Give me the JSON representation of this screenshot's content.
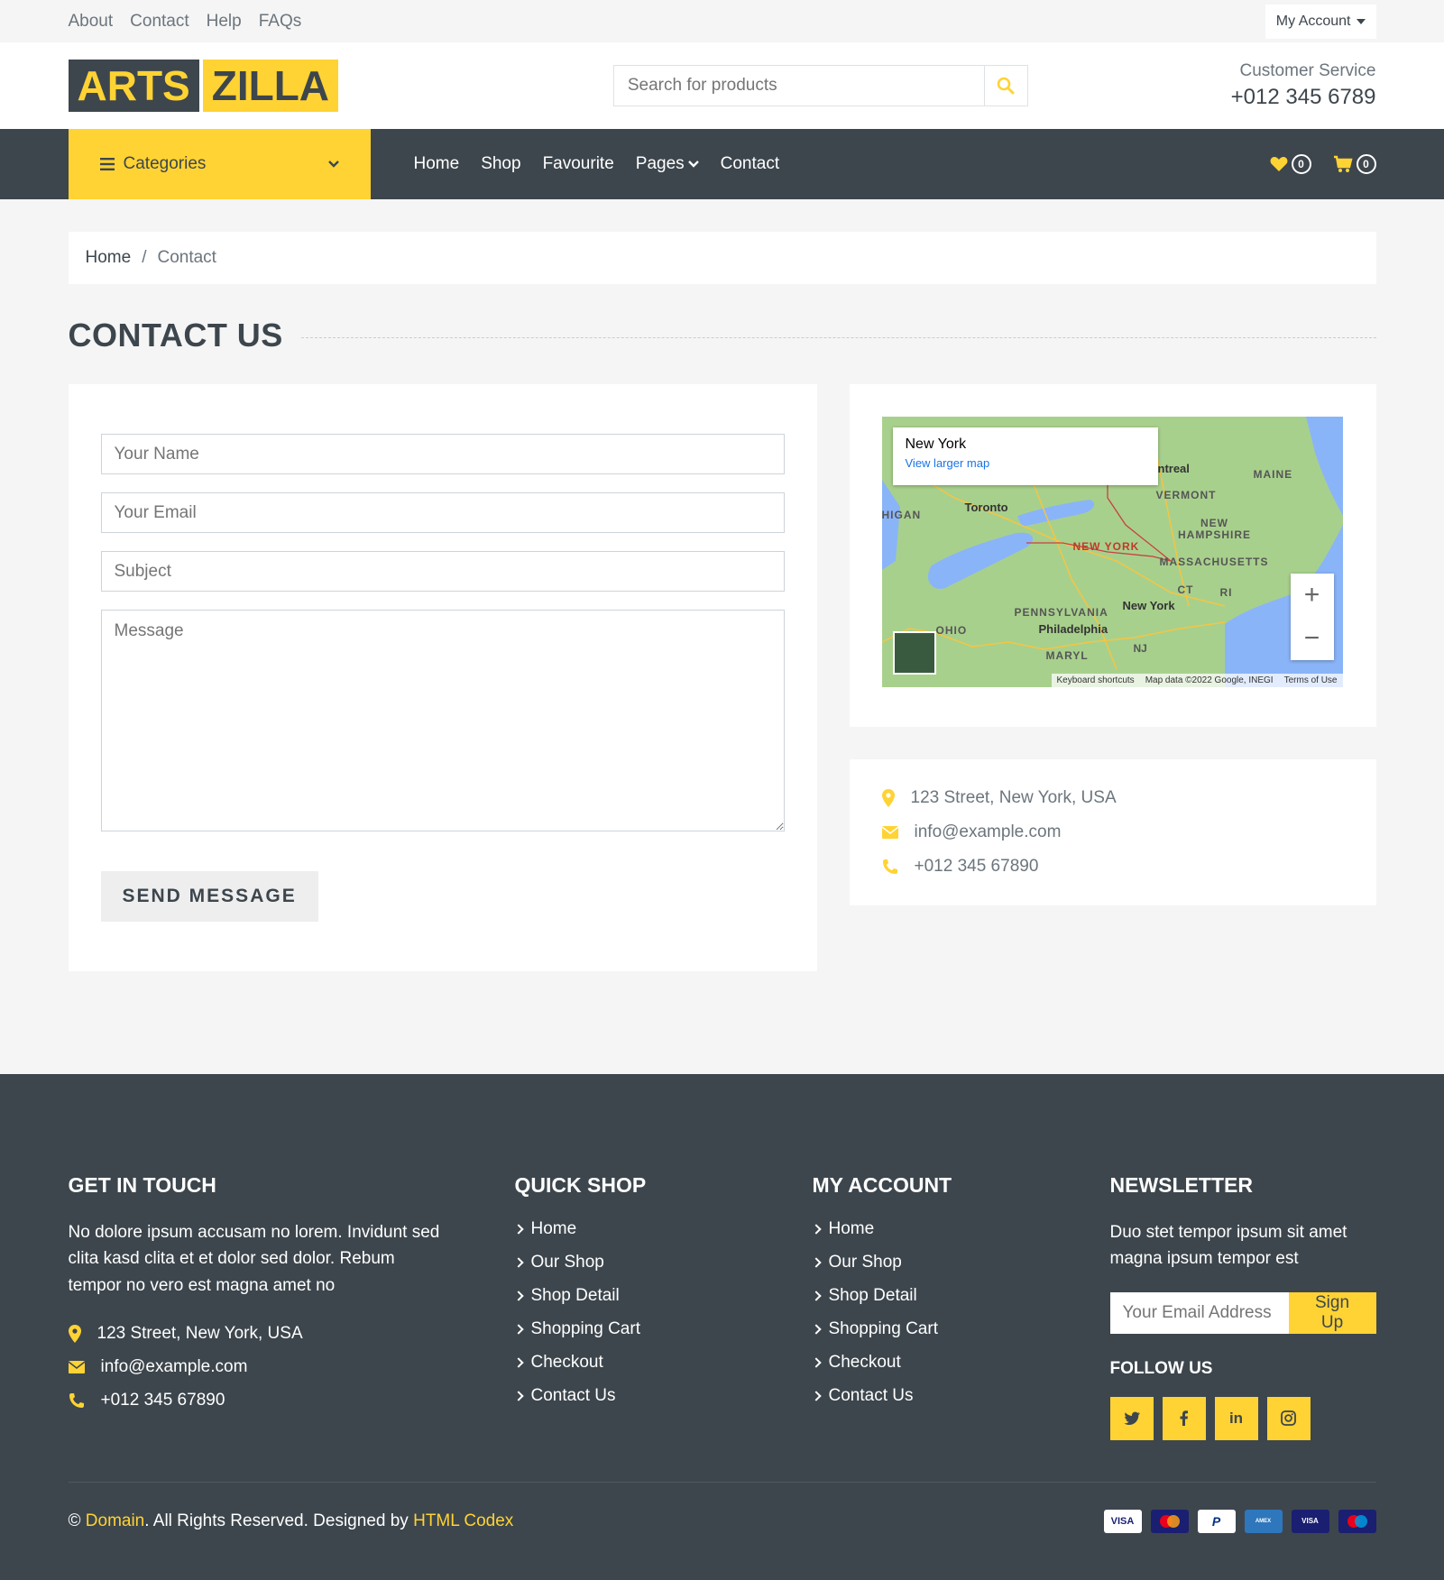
{
  "topbar": {
    "links": [
      "About",
      "Contact",
      "Help",
      "FAQs"
    ],
    "account_label": "My Account"
  },
  "header": {
    "logo_part1": "ARTS",
    "logo_part2": "ZILLA",
    "search_placeholder": "Search for products",
    "cs_title": "Customer Service",
    "cs_phone": "+012 345 6789"
  },
  "nav": {
    "categories_label": "Categories",
    "menu": [
      "Home",
      "Shop",
      "Favourite",
      "Pages",
      "Contact"
    ],
    "wishlist_count": "0",
    "cart_count": "0"
  },
  "breadcrumb": {
    "home": "Home",
    "separator": "/",
    "current": "Contact"
  },
  "page_title": "CONTACT US",
  "form": {
    "name_placeholder": "Your Name",
    "email_placeholder": "Your Email",
    "subject_placeholder": "Subject",
    "message_placeholder": "Message",
    "send_label": "SEND MESSAGE"
  },
  "map": {
    "place": "New York",
    "view_larger": "View larger map",
    "labels": {
      "toronto": "Toronto",
      "new_york_state": "NEW YORK",
      "vermont": "VERMONT",
      "maine": "MAINE",
      "new_hampshire": "NEW HAMPSHIRE",
      "massachusetts": "MASSACHUSETTS",
      "ct": "CT",
      "ri": "RI",
      "pennsylvania": "PENNSYLVANIA",
      "new_york_city": "New York",
      "philadelphia": "Philadelphia",
      "nj": "NJ",
      "montreal": "ntreal",
      "michigan": "HIGAN",
      "ohio": "OHIO",
      "maryland": "MARYL"
    },
    "footer": [
      "Keyboard shortcuts",
      "Map data ©2022 Google, INEGI",
      "Terms of Use"
    ],
    "zoom_in": "+",
    "zoom_out": "−"
  },
  "contact_info": {
    "address": "123 Street, New York, USA",
    "email": "info@example.com",
    "phone": "+012 345 67890"
  },
  "footer": {
    "touch_title": "GET IN TOUCH",
    "touch_text": "No dolore ipsum accusam no lorem. Invidunt sed clita kasd clita et et dolor sed dolor. Rebum tempor no vero est magna amet no",
    "address": "123 Street, New York, USA",
    "email": "info@example.com",
    "phone": "+012 345 67890",
    "quick_title": "QUICK SHOP",
    "quick_links": [
      "Home",
      "Our Shop",
      "Shop Detail",
      "Shopping Cart",
      "Checkout",
      "Contact Us"
    ],
    "account_title": "MY ACCOUNT",
    "account_links": [
      "Home",
      "Our Shop",
      "Shop Detail",
      "Shopping Cart",
      "Checkout",
      "Contact Us"
    ],
    "newsletter_title": "NEWSLETTER",
    "newsletter_text": "Duo stet tempor ipsum sit amet magna ipsum tempor est",
    "newsletter_placeholder": "Your Email Address",
    "signup_label": "Sign Up",
    "follow_title": "FOLLOW US",
    "socials": [
      "twitter-icon",
      "facebook-icon",
      "linkedin-icon",
      "instagram-icon"
    ],
    "copyright_prefix": "©",
    "copyright_domain": "Domain",
    "copyright_mid": ". All Rights Reserved. Designed by",
    "copyright_designer": "HTML Codex",
    "payments": [
      "VISA",
      "MasterCard",
      "PayPal",
      "AMERICAN EXPRESS",
      "VISA Electron",
      "Maestro"
    ]
  },
  "colors": {
    "accent": "#ffd333",
    "dark": "#3d464d",
    "muted": "#6c757d",
    "bg": "#f5f5f5"
  }
}
